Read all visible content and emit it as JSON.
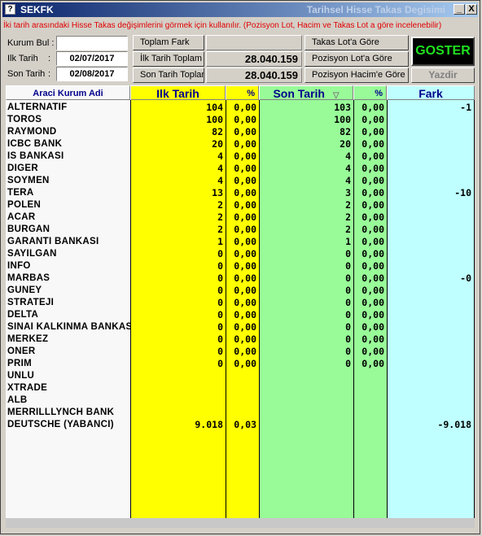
{
  "window": {
    "app_title": "SEKFK",
    "title": "Tarihsel Hisse Takas Degisimi",
    "minimize_icon": "minimize-icon",
    "close_icon": "close-icon",
    "minimize_label": "_",
    "close_label": "X"
  },
  "info_text": "İki tarih arasındaki Hisse Takas değişimlerini görmek için kullanılır. (Pozisyon Lot, Hacim ve Takas Lot a göre incelenebilir)",
  "form": {
    "kurum_bul_label": "Kurum Bul :",
    "kurum_bul_value": "",
    "ilk_tarih_label": "Ilk Tarih",
    "ilk_tarih_colon": ":",
    "ilk_tarih_value": "02/07/2017",
    "son_tarih_label": "Son Tarih",
    "son_tarih_colon": ":",
    "son_tarih_value": "02/08/2017"
  },
  "totals": {
    "toplam_fark_label": "Toplam Fark",
    "toplam_fark_value": "",
    "ilk_tarih_toplam_label": "İlk Tarih Toplam",
    "ilk_tarih_toplam_value": "28.040.159",
    "son_tarih_toplam_label": "Son Tarih Toplam",
    "son_tarih_toplam_value": "28.040.159"
  },
  "buttons": {
    "takas_lot": "Takas Lot'a Göre",
    "pozisyon_lot": "Pozisyon Lot'a Göre",
    "pozisyon_hacim": "Pozisyon Hacim'e Göre",
    "goster": "GOSTER",
    "yazdir": "Yazdir"
  },
  "colors": {
    "yellow": "#ffff00",
    "green": "#98fb98",
    "cyan": "#bfffff",
    "name_bg": "#f8f8f8",
    "goster_text": "#20e020",
    "info_text": "#e00000"
  },
  "table": {
    "headers": {
      "name": "Araci Kurum Adi",
      "ilk": "Ilk Tarih",
      "ilk_pct": "%",
      "son": "Son Tarih",
      "son_sort_icon": "sort-down-icon",
      "son_pct": "%",
      "fark": "Fark"
    },
    "rows": [
      {
        "name": "ALTERNATIF",
        "ilk": "104",
        "ilk_pct": "0,00",
        "son": "103",
        "son_pct": "0,00",
        "fark": "-1"
      },
      {
        "name": "TOROS",
        "ilk": "100",
        "ilk_pct": "0,00",
        "son": "100",
        "son_pct": "0,00",
        "fark": ""
      },
      {
        "name": "RAYMOND",
        "ilk": "82",
        "ilk_pct": "0,00",
        "son": "82",
        "son_pct": "0,00",
        "fark": ""
      },
      {
        "name": "ICBC BANK",
        "ilk": "20",
        "ilk_pct": "0,00",
        "son": "20",
        "son_pct": "0,00",
        "fark": ""
      },
      {
        "name": "IS BANKASI",
        "ilk": "4",
        "ilk_pct": "0,00",
        "son": "4",
        "son_pct": "0,00",
        "fark": ""
      },
      {
        "name": "DIGER",
        "ilk": "4",
        "ilk_pct": "0,00",
        "son": "4",
        "son_pct": "0,00",
        "fark": ""
      },
      {
        "name": "SOYMEN",
        "ilk": "4",
        "ilk_pct": "0,00",
        "son": "4",
        "son_pct": "0,00",
        "fark": ""
      },
      {
        "name": "TERA",
        "ilk": "13",
        "ilk_pct": "0,00",
        "son": "3",
        "son_pct": "0,00",
        "fark": "-10"
      },
      {
        "name": "POLEN",
        "ilk": "2",
        "ilk_pct": "0,00",
        "son": "2",
        "son_pct": "0,00",
        "fark": ""
      },
      {
        "name": "ACAR",
        "ilk": "2",
        "ilk_pct": "0,00",
        "son": "2",
        "son_pct": "0,00",
        "fark": ""
      },
      {
        "name": "BURGAN",
        "ilk": "2",
        "ilk_pct": "0,00",
        "son": "2",
        "son_pct": "0,00",
        "fark": ""
      },
      {
        "name": "GARANTI BANKASI",
        "ilk": "1",
        "ilk_pct": "0,00",
        "son": "1",
        "son_pct": "0,00",
        "fark": ""
      },
      {
        "name": "SAYILGAN",
        "ilk": "0",
        "ilk_pct": "0,00",
        "son": "0",
        "son_pct": "0,00",
        "fark": ""
      },
      {
        "name": "INFO",
        "ilk": "0",
        "ilk_pct": "0,00",
        "son": "0",
        "son_pct": "0,00",
        "fark": ""
      },
      {
        "name": "MARBAS",
        "ilk": "0",
        "ilk_pct": "0,00",
        "son": "0",
        "son_pct": "0,00",
        "fark": "-0"
      },
      {
        "name": "GUNEY",
        "ilk": "0",
        "ilk_pct": "0,00",
        "son": "0",
        "son_pct": "0,00",
        "fark": ""
      },
      {
        "name": "STRATEJI",
        "ilk": "0",
        "ilk_pct": "0,00",
        "son": "0",
        "son_pct": "0,00",
        "fark": ""
      },
      {
        "name": "DELTA",
        "ilk": "0",
        "ilk_pct": "0,00",
        "son": "0",
        "son_pct": "0,00",
        "fark": ""
      },
      {
        "name": "SINAI KALKINMA BANKASI",
        "ilk": "0",
        "ilk_pct": "0,00",
        "son": "0",
        "son_pct": "0,00",
        "fark": ""
      },
      {
        "name": "MERKEZ",
        "ilk": "0",
        "ilk_pct": "0,00",
        "son": "0",
        "son_pct": "0,00",
        "fark": ""
      },
      {
        "name": "ONER",
        "ilk": "0",
        "ilk_pct": "0,00",
        "son": "0",
        "son_pct": "0,00",
        "fark": ""
      },
      {
        "name": "PRIM",
        "ilk": "0",
        "ilk_pct": "0,00",
        "son": "0",
        "son_pct": "0,00",
        "fark": ""
      },
      {
        "name": "UNLU",
        "ilk": "",
        "ilk_pct": "",
        "son": "",
        "son_pct": "",
        "fark": ""
      },
      {
        "name": "XTRADE",
        "ilk": "",
        "ilk_pct": "",
        "son": "",
        "son_pct": "",
        "fark": ""
      },
      {
        "name": "ALB",
        "ilk": "",
        "ilk_pct": "",
        "son": "",
        "son_pct": "",
        "fark": ""
      },
      {
        "name": "MERRILLLYNCH BANK",
        "ilk": "",
        "ilk_pct": "",
        "son": "",
        "son_pct": "",
        "fark": ""
      },
      {
        "name": "DEUTSCHE (YABANCI)",
        "ilk": "9.018",
        "ilk_pct": "0,03",
        "son": "",
        "son_pct": "",
        "fark": "-9.018"
      }
    ]
  }
}
